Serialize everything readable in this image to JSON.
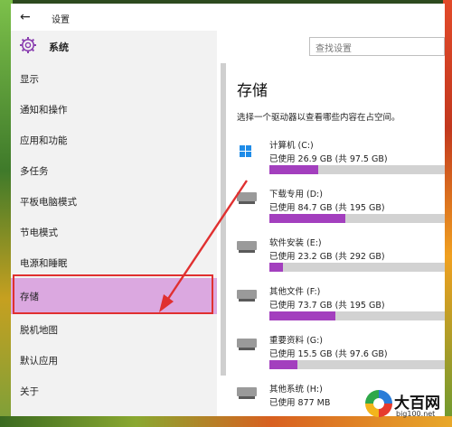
{
  "window": {
    "title": "设置",
    "back_icon": "←"
  },
  "sidebar": {
    "header": "系统",
    "items": [
      {
        "label": "显示"
      },
      {
        "label": "通知和操作"
      },
      {
        "label": "应用和功能"
      },
      {
        "label": "多任务"
      },
      {
        "label": "平板电脑模式"
      },
      {
        "label": "节电模式"
      },
      {
        "label": "电源和睡眠"
      },
      {
        "label": "存储",
        "active": true
      },
      {
        "label": "脱机地图"
      },
      {
        "label": "默认应用"
      },
      {
        "label": "关于"
      }
    ]
  },
  "search": {
    "placeholder": "查找设置"
  },
  "main": {
    "title": "存储",
    "description": "选择一个驱动器以查看哪些内容在占空间。",
    "drives": [
      {
        "name": "计算机 (C:)",
        "usage": "已使用 26.9 GB (共 97.5 GB)",
        "fraction": 0.276,
        "icon": "windows-logo-icon"
      },
      {
        "name": "下载专用 (D:)",
        "usage": "已使用 84.7 GB (共 195 GB)",
        "fraction": 0.434,
        "icon": "hard-drive-icon"
      },
      {
        "name": "软件安装 (E:)",
        "usage": "已使用 23.2 GB (共 292 GB)",
        "fraction": 0.079,
        "icon": "hard-drive-icon"
      },
      {
        "name": "其他文件 (F:)",
        "usage": "已使用 73.7 GB (共 195 GB)",
        "fraction": 0.378,
        "icon": "hard-drive-icon"
      },
      {
        "name": "重要资料 (G:)",
        "usage": "已使用 15.5 GB (共 97.6 GB)",
        "fraction": 0.159,
        "icon": "hard-drive-icon"
      },
      {
        "name": "其他系统 (H:)",
        "usage": "已使用 877 MB",
        "fraction": 0.05,
        "icon": "hard-drive-icon"
      }
    ]
  },
  "colors": {
    "accent": "#a33fbe",
    "active_nav": "#dba8e0",
    "annotation": "#e03030"
  },
  "watermark": {
    "brand": "大百网",
    "url": "big100.net"
  }
}
